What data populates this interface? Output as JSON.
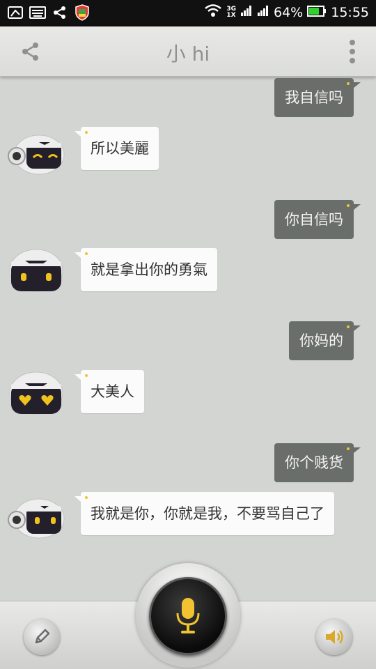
{
  "status_bar": {
    "battery": "64%",
    "time": "15:55",
    "network_top": "3G",
    "network_bottom": "1X",
    "icons": [
      "image-icon",
      "keyboard-icon",
      "share-icon",
      "shield-icon",
      "wifi-icon",
      "signal-icon",
      "battery-icon"
    ]
  },
  "header": {
    "title": "小 hi",
    "left_icon": "share-icon",
    "right_icon": "overflow-menu-icon"
  },
  "messages": [
    {
      "side": "right",
      "text": "我自信吗"
    },
    {
      "side": "left",
      "text": "所以美麗",
      "avatar": "robot-smile"
    },
    {
      "side": "right",
      "text": "你自信吗"
    },
    {
      "side": "left",
      "text": "就是拿出你的勇氣",
      "avatar": "robot-eyes"
    },
    {
      "side": "right",
      "text": "你妈的"
    },
    {
      "side": "left",
      "text": "大美人",
      "avatar": "robot-hearts"
    },
    {
      "side": "right",
      "text": "你个贱货"
    },
    {
      "side": "left",
      "text": "我就是你，你就是我，不要骂自己了",
      "avatar": "robot-side"
    }
  ],
  "bottom": {
    "left_icon": "pencil-icon",
    "center_icon": "microphone-icon",
    "right_icon": "speaker-icon"
  },
  "colors": {
    "background": "#d3d5d2",
    "right_bubble": "#6a6e6a",
    "left_bubble": "#fbfbfb",
    "accent": "#f2c230"
  }
}
